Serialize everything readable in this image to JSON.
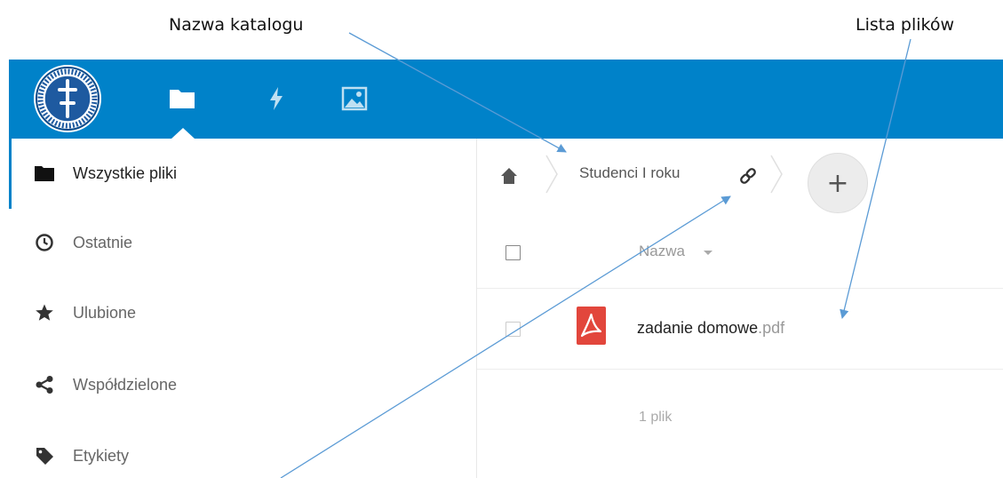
{
  "callouts": {
    "directory_name": "Nazwa katalogu",
    "file_list": "Lista plików"
  },
  "header": {
    "logo_icon": "university-seal-icon",
    "apps": [
      {
        "name": "files",
        "icon": "folder-icon",
        "active": true
      },
      {
        "name": "activity",
        "icon": "lightning-icon",
        "active": false
      },
      {
        "name": "gallery",
        "icon": "image-icon",
        "active": false
      }
    ],
    "bg_color": "#0082c9"
  },
  "sidebar": {
    "items": [
      {
        "label": "Wszystkie pliki",
        "icon": "folder-icon",
        "active": true
      },
      {
        "label": "Ostatnie",
        "icon": "clock-icon"
      },
      {
        "label": "Ulubione",
        "icon": "star-icon"
      },
      {
        "label": "Współdzielone",
        "icon": "share-icon"
      },
      {
        "label": "Etykiety",
        "icon": "tag-icon"
      }
    ]
  },
  "breadcrumb": {
    "home_icon": "home-icon",
    "current": "Studenci I roku",
    "link_icon": "link-icon",
    "new_button": "+"
  },
  "file_list": {
    "column_name": "Nazwa",
    "files": [
      {
        "base": "zadanie domowe",
        "ext": ".pdf",
        "icon": "pdf-icon"
      }
    ],
    "summary": "1 plik"
  },
  "colors": {
    "accent": "#0082c9",
    "pdf": "#e2463c",
    "callout_arrow": "#5b9bd5"
  }
}
